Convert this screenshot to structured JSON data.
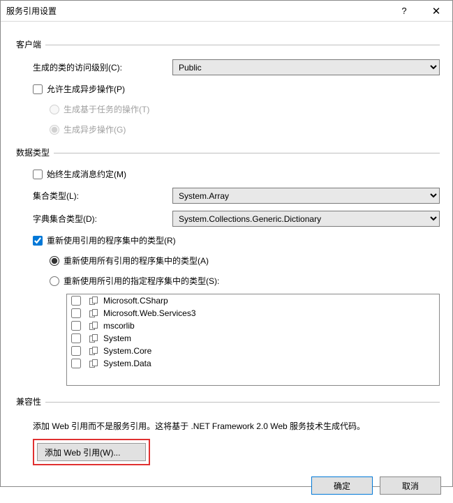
{
  "titlebar": {
    "title": "服务引用设置"
  },
  "client": {
    "header": "客户端",
    "access_level_label": "生成的类的访问级别(C):",
    "access_level_value": "Public",
    "allow_async_label": "允许生成异步操作(P)",
    "allow_async_checked": false,
    "task_based_label": "生成基于任务的操作(T)",
    "async_ops_label": "生成异步操作(G)"
  },
  "datatypes": {
    "header": "数据类型",
    "always_msg_contracts_label": "始终生成消息约定(M)",
    "always_msg_contracts_checked": false,
    "collection_type_label": "集合类型(L):",
    "collection_type_value": "System.Array",
    "dictionary_type_label": "字典集合类型(D):",
    "dictionary_type_value": "System.Collections.Generic.Dictionary",
    "reuse_types_label": "重新使用引用的程序集中的类型(R)",
    "reuse_types_checked": true,
    "reuse_all_label": "重新使用所有引用的程序集中的类型(A)",
    "reuse_specified_label": "重新使用所引用的指定程序集中的类型(S):",
    "reuse_mode": "all",
    "assemblies": [
      "Microsoft.CSharp",
      "Microsoft.Web.Services3",
      "mscorlib",
      "System",
      "System.Core",
      "System.Data"
    ]
  },
  "compat": {
    "header": "兼容性",
    "text": "添加 Web 引用而不是服务引用。这将基于 .NET Framework 2.0 Web 服务技术生成代码。",
    "button_label": "添加 Web 引用(W)..."
  },
  "footer": {
    "ok": "确定",
    "cancel": "取消"
  }
}
